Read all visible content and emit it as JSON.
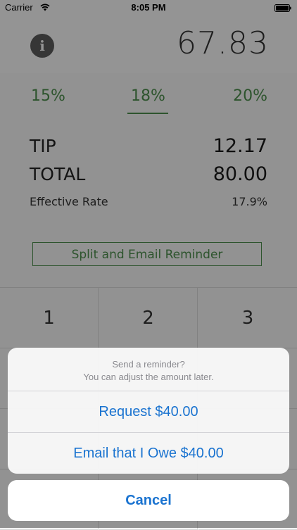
{
  "status_bar": {
    "carrier": "Carrier",
    "time": "8:05 PM"
  },
  "header": {
    "info_icon_glyph": "i",
    "bill_amount": "67.83"
  },
  "tip_options": [
    {
      "label": "15%"
    },
    {
      "label": "18%",
      "selected": true
    },
    {
      "label": "20%"
    }
  ],
  "summary": {
    "tip_label": "TIP",
    "tip_value": "12.17",
    "total_label": "TOTAL",
    "total_value": "80.00",
    "rate_label": "Effective Rate",
    "rate_value": "17.9%"
  },
  "split_button_label": "Split and Email Reminder",
  "keypad": {
    "keys": [
      "1",
      "2",
      "3"
    ]
  },
  "action_sheet": {
    "title": "Send a reminder?",
    "message": "You can adjust the amount later.",
    "actions": [
      {
        "label": "Request $40.00"
      },
      {
        "label": "Email that I Owe $40.00"
      }
    ],
    "cancel_label": "Cancel"
  },
  "colors": {
    "accent_green": "#4c8c4c",
    "action_blue": "#1a73d0"
  }
}
